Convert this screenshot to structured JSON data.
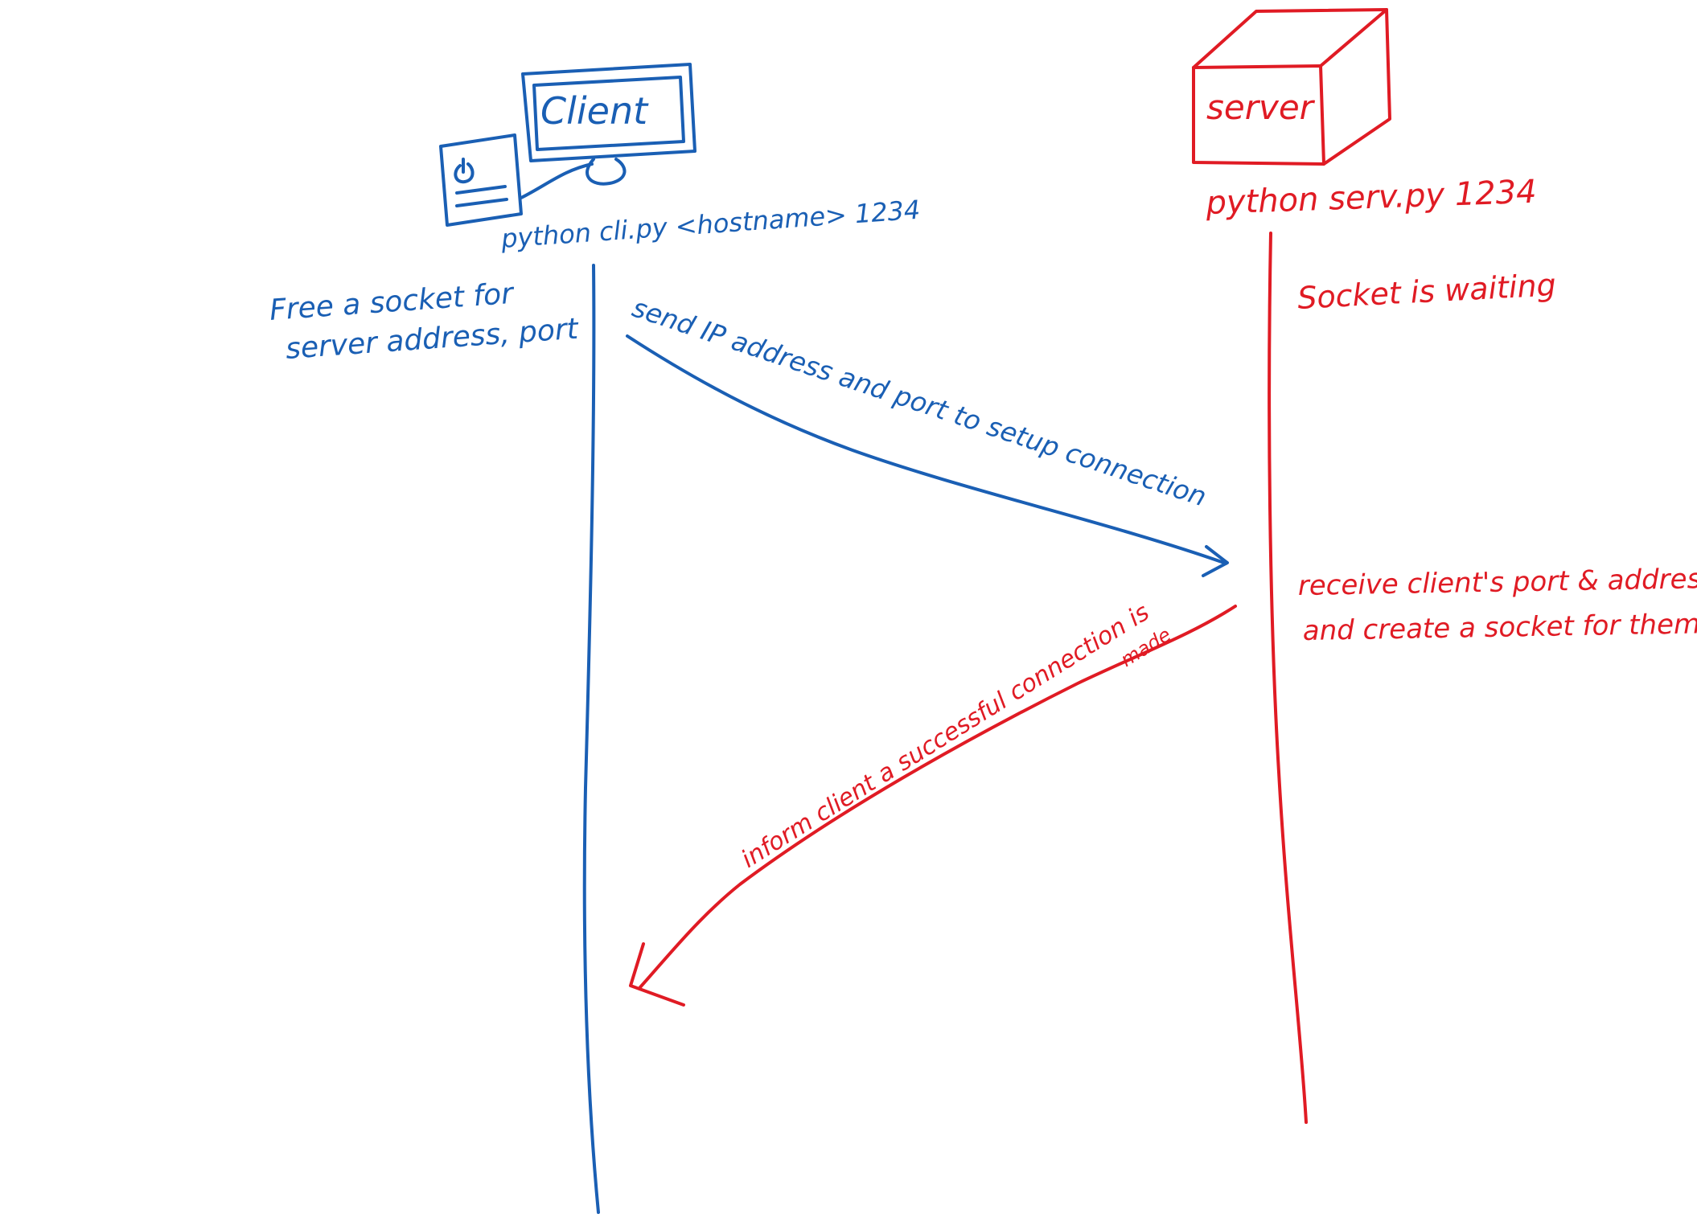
{
  "colors": {
    "client": "#1a5fb4",
    "server": "#e01b24",
    "background": "#ffffff"
  },
  "client": {
    "label": "Client",
    "command": "python cli.py <hostname> 1234",
    "note_line1": "Free a socket for",
    "note_line2": "server address, port",
    "icon": "computer-icon"
  },
  "server": {
    "label": "server",
    "command": "python serv.py 1234",
    "note_waiting": "Socket is waiting",
    "note_receive_line1": "receive client's port & address",
    "note_receive_line2": "and create a socket for them",
    "icon": "server-box-icon"
  },
  "messages": {
    "request": "send IP address and port to setup connection",
    "response": "inform client a successful connection is",
    "response_tail": "made"
  }
}
